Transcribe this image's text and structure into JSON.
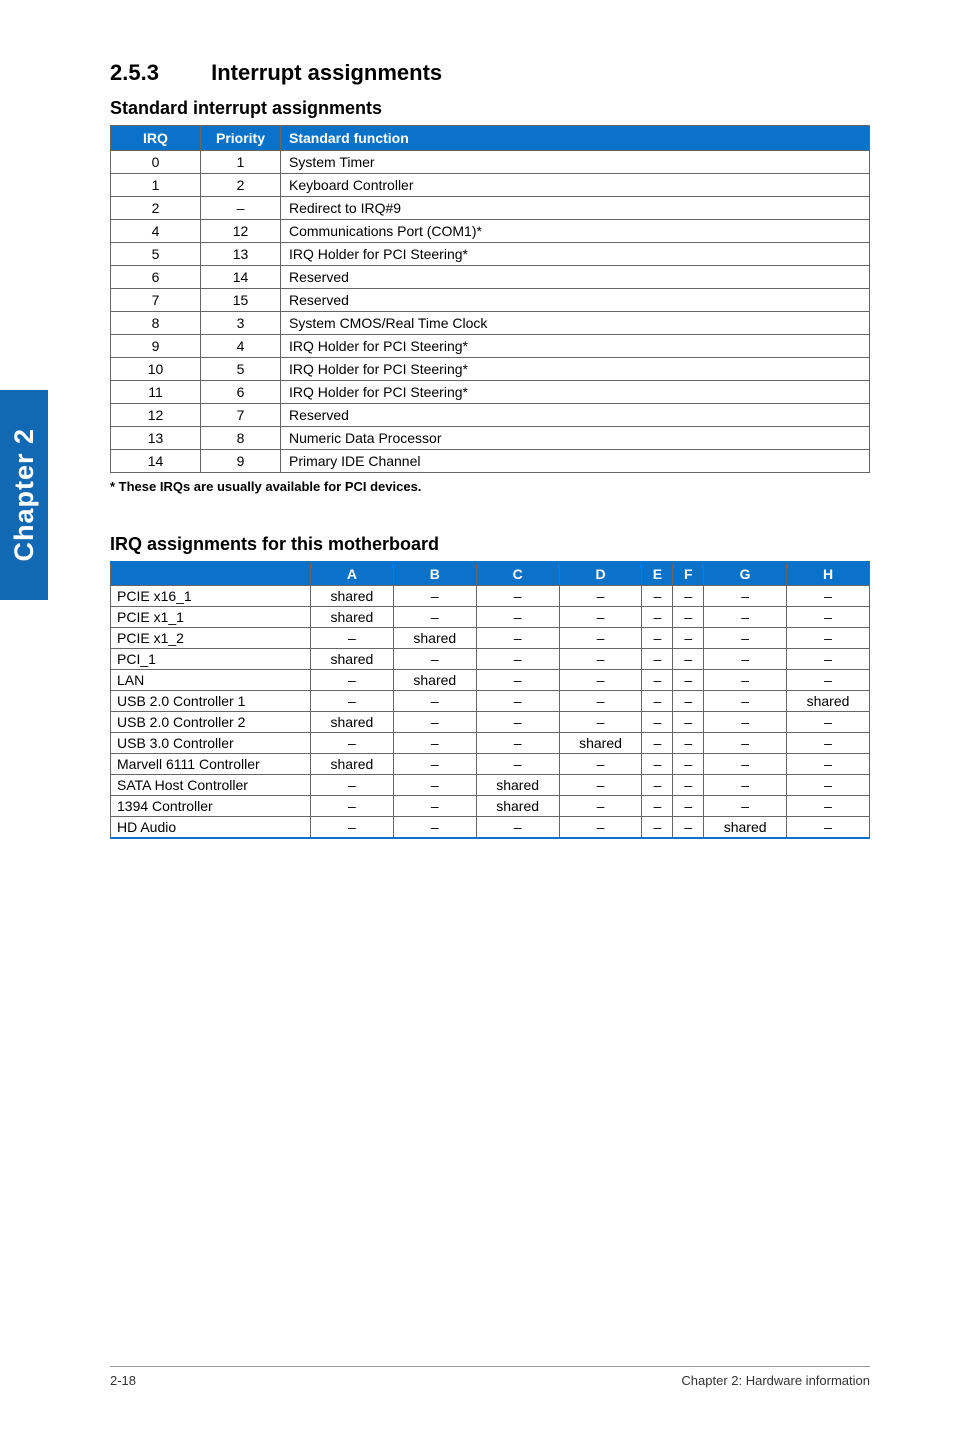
{
  "chapter_tab": "Chapter 2",
  "section": {
    "number": "2.5.3",
    "title": "Interrupt assignments"
  },
  "sub1": "Standard interrupt assignments",
  "irq_headers": {
    "irq": "IRQ",
    "priority": "Priority",
    "func": "Standard function"
  },
  "irq_rows": [
    {
      "irq": "0",
      "pri": "1",
      "func": "System Timer"
    },
    {
      "irq": "1",
      "pri": "2",
      "func": "Keyboard Controller"
    },
    {
      "irq": "2",
      "pri": "–",
      "func": "Redirect to IRQ#9"
    },
    {
      "irq": "4",
      "pri": "12",
      "func": "Communications Port (COM1)*"
    },
    {
      "irq": "5",
      "pri": "13",
      "func": "IRQ Holder for PCI Steering*"
    },
    {
      "irq": "6",
      "pri": "14",
      "func": "Reserved"
    },
    {
      "irq": "7",
      "pri": "15",
      "func": "Reserved"
    },
    {
      "irq": "8",
      "pri": "3",
      "func": "System CMOS/Real Time Clock"
    },
    {
      "irq": "9",
      "pri": "4",
      "func": "IRQ Holder for PCI Steering*"
    },
    {
      "irq": "10",
      "pri": "5",
      "func": "IRQ Holder for PCI Steering*"
    },
    {
      "irq": "11",
      "pri": "6",
      "func": "IRQ Holder for PCI Steering*"
    },
    {
      "irq": "12",
      "pri": "7",
      "func": "Reserved"
    },
    {
      "irq": "13",
      "pri": "8",
      "func": "Numeric Data Processor"
    },
    {
      "irq": "14",
      "pri": "9",
      "func": "Primary IDE Channel"
    }
  ],
  "footnote": "* These IRQs are usually available for PCI devices.",
  "sub2": "IRQ assignments for this motherboard",
  "assign_headers": [
    "",
    "A",
    "B",
    "C",
    "D",
    "E",
    "F",
    "G",
    "H"
  ],
  "assign_rows": [
    {
      "label": "PCIE x16_1",
      "cells": [
        "shared",
        "–",
        "–",
        "–",
        "–",
        "–",
        "–",
        "–"
      ]
    },
    {
      "label": "PCIE x1_1",
      "cells": [
        "shared",
        "–",
        "–",
        "–",
        "–",
        "–",
        "–",
        "–"
      ]
    },
    {
      "label": "PCIE x1_2",
      "cells": [
        "–",
        "shared",
        "–",
        "–",
        "–",
        "–",
        "–",
        "–"
      ]
    },
    {
      "label": "PCI_1",
      "cells": [
        "shared",
        "–",
        "–",
        "–",
        "–",
        "–",
        "–",
        "–"
      ]
    },
    {
      "label": "LAN",
      "cells": [
        "–",
        "shared",
        "–",
        "–",
        "–",
        "–",
        "–",
        "–"
      ]
    },
    {
      "label": "USB 2.0 Controller 1",
      "cells": [
        "–",
        "–",
        "–",
        "–",
        "–",
        "–",
        "–",
        "shared"
      ]
    },
    {
      "label": "USB 2.0 Controller 2",
      "cells": [
        "shared",
        "–",
        "–",
        "–",
        "–",
        "–",
        "–",
        "–"
      ]
    },
    {
      "label": "USB 3.0 Controller",
      "cells": [
        "–",
        "–",
        "–",
        "shared",
        "–",
        "–",
        "–",
        "–"
      ]
    },
    {
      "label": "Marvell 6111 Controller",
      "cells": [
        "shared",
        "–",
        "–",
        "–",
        "–",
        "–",
        "–",
        "–"
      ]
    },
    {
      "label": "SATA Host Controller",
      "cells": [
        "–",
        "–",
        "shared",
        "–",
        "–",
        "–",
        "–",
        "–"
      ]
    },
    {
      "label": "1394 Controller",
      "cells": [
        "–",
        "–",
        "shared",
        "–",
        "–",
        "–",
        "–",
        "–"
      ]
    },
    {
      "label": "HD Audio",
      "cells": [
        "–",
        "–",
        "–",
        "–",
        "–",
        "–",
        "shared",
        "–"
      ]
    }
  ],
  "footer": {
    "left": "2-18",
    "right": "Chapter 2: Hardware information"
  }
}
